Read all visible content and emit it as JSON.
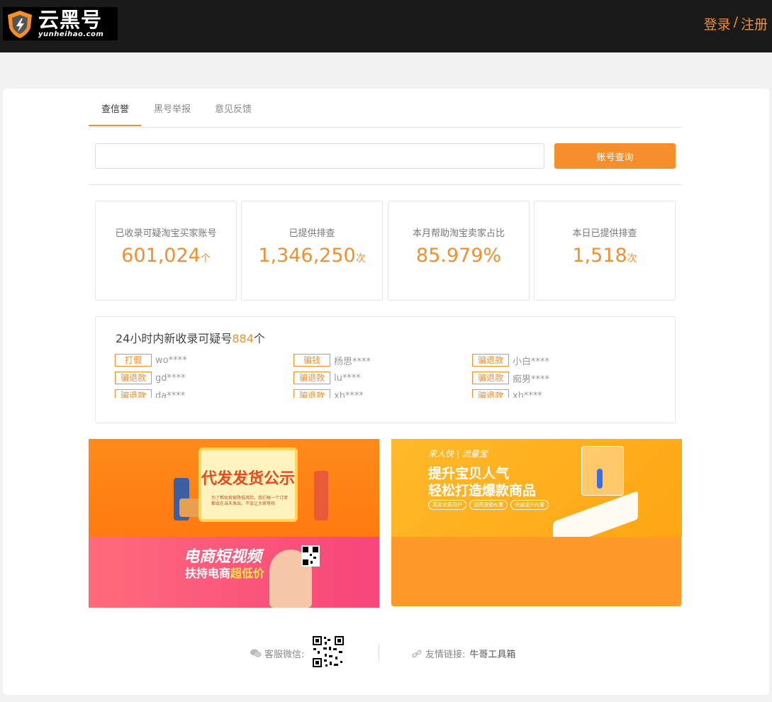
{
  "header": {
    "logo_cn": "云黑号",
    "logo_en": "yunheihao.com",
    "login": "登录",
    "separator": "/",
    "register": "注册"
  },
  "tabs": [
    "查信誉",
    "黑号举报",
    "意见反馈"
  ],
  "search": {
    "input_value": "",
    "button": "账号查询"
  },
  "stats": [
    {
      "label": "已收录可疑淘宝买家账号",
      "value": "601,024",
      "unit": "个"
    },
    {
      "label": "已提供排查",
      "value": "1,346,250",
      "unit": "次"
    },
    {
      "label": "本月帮助淘宝卖家占比",
      "value": "85.979%",
      "unit": ""
    },
    {
      "label": "本日已提供排查",
      "value": "1,518",
      "unit": "次"
    }
  ],
  "recent": {
    "title_prefix": "24小时内新收录可疑号",
    "count": "884",
    "title_suffix": "个",
    "items": [
      {
        "tag": "打假",
        "name": "wo****"
      },
      {
        "tag": "骗钱",
        "name": "杨思****"
      },
      {
        "tag": "骗退款",
        "name": "小白****"
      },
      {
        "tag": "骗退款",
        "name": "gd****"
      },
      {
        "tag": "骗退款",
        "name": "lu****"
      },
      {
        "tag": "骗退款",
        "name": "痴男****"
      },
      {
        "tag": "骗退款",
        "name": "da****"
      },
      {
        "tag": "骗退款",
        "name": "xh****"
      },
      {
        "tag": "骗退款",
        "name": "xh****"
      }
    ]
  },
  "banners": {
    "b1": {
      "title": "代发发货公示",
      "desc": "为了帮助卖家降低风险，我们每一个订单都会在当天发出，不会让大家等待"
    },
    "b2": {
      "title": "电商短视频",
      "sub_prefix": "扶持电商",
      "sub_highlight": "超低价"
    },
    "b3": {
      "brand": "来人快 | 流量宝",
      "line1": "提升宝贝人气",
      "line2": "轻松打造爆款商品",
      "pills": [
        "真实优质用户",
        "提高搜索权重",
        "快速提升权重"
      ]
    }
  },
  "footer": {
    "wechat_label": "客服微信:",
    "links_label": "友情链接:",
    "link": "牛哥工具箱"
  },
  "colors": {
    "accent": "#f68e2b",
    "header_bg": "#1a1a1a",
    "page_bg": "#f2f2f2"
  }
}
